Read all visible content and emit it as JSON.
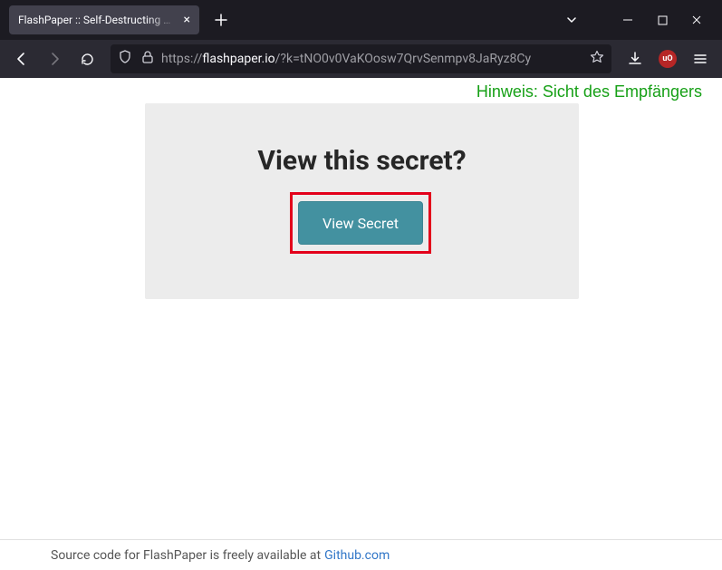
{
  "browser": {
    "tab_title": "FlashPaper :: Self-Destructing Message",
    "url_protocol": "https://",
    "url_domain": "flashpaper.io",
    "url_path": "/?k=tNO0v0VaKOosw7QrvSenmpv8JaRyz8Cy",
    "ext_badge": "uO"
  },
  "annotation": "Hinweis: Sicht des Empfängers",
  "card": {
    "heading": "View this secret?",
    "button_label": "View Secret"
  },
  "footer": {
    "text": "Source code for FlashPaper is freely available at",
    "link": "Github.com"
  }
}
